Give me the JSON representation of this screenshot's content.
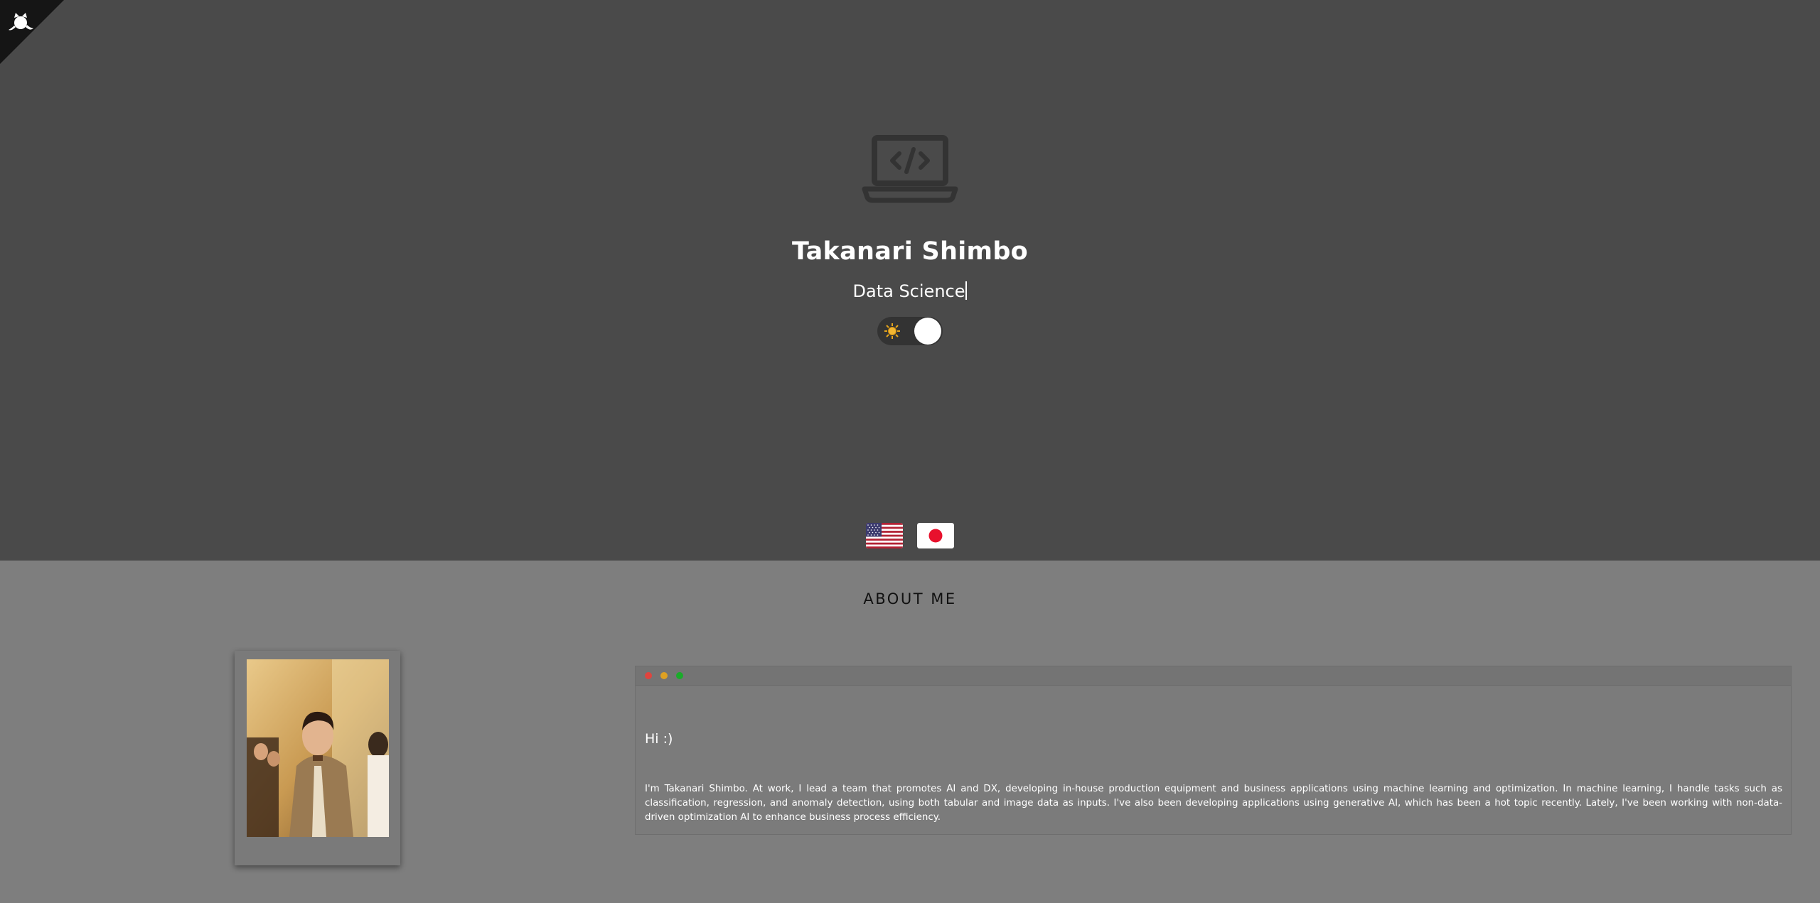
{
  "hero": {
    "name": "Takanari Shimbo",
    "role": "Data Science",
    "theme_toggle": {
      "sun_icon": "sun-icon",
      "state": "light"
    },
    "languages": [
      {
        "icon": "us-flag-icon"
      },
      {
        "icon": "japan-flag-icon"
      }
    ],
    "colors": {
      "hero_bg": "#4a4a4a",
      "page_bg": "#7e7e7e",
      "icon": "#333333"
    }
  },
  "about": {
    "title": "ABOUT ME",
    "greeting": "Hi :)",
    "intro": "I'm Takanari Shimbo. At work, I lead a team that promotes AI and DX, developing in-house production equipment and business applications using machine learning and optimization. In machine learning, I handle tasks such as classification, regression, and anomaly detection, using both tabular and image data as inputs. I've also been developing applications using generative AI, which has been a hot topic recently. Lately, I've been working with non-data-driven optimization AI to enhance business process efficiency.",
    "window_dots": [
      "#e0443e",
      "#dea123",
      "#1aab29"
    ]
  }
}
